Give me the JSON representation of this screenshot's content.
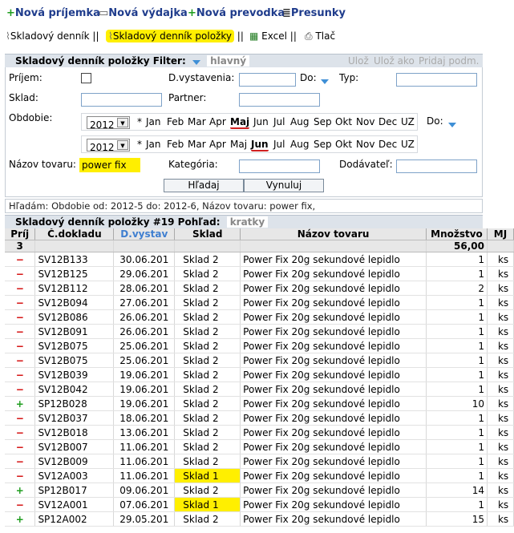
{
  "toolbar": {
    "new_receipt": "Nová príjemka",
    "new_issue": "Nová výdajka",
    "new_transfer": "Nová prevodka",
    "transfers": "Presunky",
    "stock_log": "Skladový denník",
    "sep1": "||",
    "stock_log_items": "Skladový denník položky",
    "sep2": "||",
    "excel": "Excel",
    "sep3": "||",
    "print": "Tlač"
  },
  "filter": {
    "title": "Skladový denník položky Filter:",
    "view": "hlavný",
    "save": "Ulož",
    "save_as": "Ulož ako",
    "add_cond": "Pridaj podm.",
    "prijem_label": "Príjem:",
    "dvystavenia_label": "D.vystavenia:",
    "do_label": "Do:",
    "typ_label": "Typ:",
    "sklad_label": "Sklad:",
    "partner_label": "Partner:",
    "obdobie_label": "Obdobie:",
    "do2_label": "Do:",
    "nazov_label": "Názov tovaru:",
    "nazov_value": "power fix",
    "kategoria_label": "Kategória:",
    "dodavatel_label": "Dodávateľ:",
    "search_btn": "Hľadaj",
    "reset_btn": "Vynuluj",
    "year1": "2012",
    "year2": "2012",
    "star": "*",
    "months": [
      "Jan",
      "Feb",
      "Mar",
      "Apr",
      "Maj",
      "Jun",
      "Jul",
      "Aug",
      "Sep",
      "Okt",
      "Nov",
      "Dec",
      "UZ"
    ]
  },
  "status": "Hľadám: Obdobie od: 2012-5 do: 2012-6, Názov tovaru: power fix,",
  "grid": {
    "title": "Skladový denník položky #19 Pohľad:",
    "view": "kratky",
    "headers": [
      "Príj",
      "Č.dokladu",
      "D.vystav",
      "Sklad",
      "Názov tovaru",
      "Množstvo",
      "MJ"
    ],
    "sum_count": "3",
    "sum_qty": "56,00",
    "rows": [
      {
        "t": "−",
        "doc": "SV12B133",
        "date": "30.06.201",
        "store": "Sklad 2",
        "name": "Power Fix 20g sekundové lepidlo",
        "qty": "1",
        "mj": "ks"
      },
      {
        "t": "−",
        "doc": "SV12B125",
        "date": "29.06.201",
        "store": "Sklad 2",
        "name": "Power Fix 20g sekundové lepidlo",
        "qty": "1",
        "mj": "ks"
      },
      {
        "t": "−",
        "doc": "SV12B112",
        "date": "28.06.201",
        "store": "Sklad 2",
        "name": "Power Fix 20g sekundové lepidlo",
        "qty": "2",
        "mj": "ks"
      },
      {
        "t": "−",
        "doc": "SV12B094",
        "date": "27.06.201",
        "store": "Sklad 2",
        "name": "Power Fix 20g sekundové lepidlo",
        "qty": "1",
        "mj": "ks"
      },
      {
        "t": "−",
        "doc": "SV12B086",
        "date": "26.06.201",
        "store": "Sklad 2",
        "name": "Power Fix 20g sekundové lepidlo",
        "qty": "1",
        "mj": "ks"
      },
      {
        "t": "−",
        "doc": "SV12B091",
        "date": "26.06.201",
        "store": "Sklad 2",
        "name": "Power Fix 20g sekundové lepidlo",
        "qty": "1",
        "mj": "ks"
      },
      {
        "t": "−",
        "doc": "SV12B075",
        "date": "25.06.201",
        "store": "Sklad 2",
        "name": "Power Fix 20g sekundové lepidlo",
        "qty": "1",
        "mj": "ks"
      },
      {
        "t": "−",
        "doc": "SV12B075",
        "date": "25.06.201",
        "store": "Sklad 2",
        "name": "Power Fix 20g sekundové lepidlo",
        "qty": "1",
        "mj": "ks"
      },
      {
        "t": "−",
        "doc": "SV12B039",
        "date": "19.06.201",
        "store": "Sklad 2",
        "name": "Power Fix 20g sekundové lepidlo",
        "qty": "1",
        "mj": "ks"
      },
      {
        "t": "−",
        "doc": "SV12B042",
        "date": "19.06.201",
        "store": "Sklad 2",
        "name": "Power Fix 20g sekundové lepidlo",
        "qty": "1",
        "mj": "ks"
      },
      {
        "t": "+",
        "doc": "SP12B028",
        "date": "19.06.201",
        "store": "Sklad 2",
        "name": "Power Fix 20g sekundové lepidlo",
        "qty": "10",
        "mj": "ks"
      },
      {
        "t": "−",
        "doc": "SV12B037",
        "date": "18.06.201",
        "store": "Sklad 2",
        "name": "Power Fix 20g sekundové lepidlo",
        "qty": "1",
        "mj": "ks"
      },
      {
        "t": "−",
        "doc": "SV12B018",
        "date": "13.06.201",
        "store": "Sklad 2",
        "name": "Power Fix 20g sekundové lepidlo",
        "qty": "1",
        "mj": "ks"
      },
      {
        "t": "−",
        "doc": "SV12B007",
        "date": "11.06.201",
        "store": "Sklad 2",
        "name": "Power Fix 20g sekundové lepidlo",
        "qty": "1",
        "mj": "ks"
      },
      {
        "t": "−",
        "doc": "SV12B009",
        "date": "11.06.201",
        "store": "Sklad 2",
        "name": "Power Fix 20g sekundové lepidlo",
        "qty": "1",
        "mj": "ks"
      },
      {
        "t": "−",
        "doc": "SV12A003",
        "date": "11.06.201",
        "store": "Sklad 1",
        "name": "Power Fix 20g sekundové lepidlo",
        "qty": "1",
        "mj": "ks",
        "hl": true
      },
      {
        "t": "+",
        "doc": "SP12B017",
        "date": "09.06.201",
        "store": "Sklad 2",
        "name": "Power Fix 20g sekundové lepidlo",
        "qty": "14",
        "mj": "ks"
      },
      {
        "t": "−",
        "doc": "SV12A001",
        "date": "07.06.201",
        "store": "Sklad 1",
        "name": "Power Fix 20g sekundové lepidlo",
        "qty": "1",
        "mj": "ks",
        "hl": true
      },
      {
        "t": "+",
        "doc": "SP12A002",
        "date": "29.05.201",
        "store": "Sklad 2",
        "name": "Power Fix 20g sekundové lepidlo",
        "qty": "15",
        "mj": "ks"
      }
    ]
  }
}
